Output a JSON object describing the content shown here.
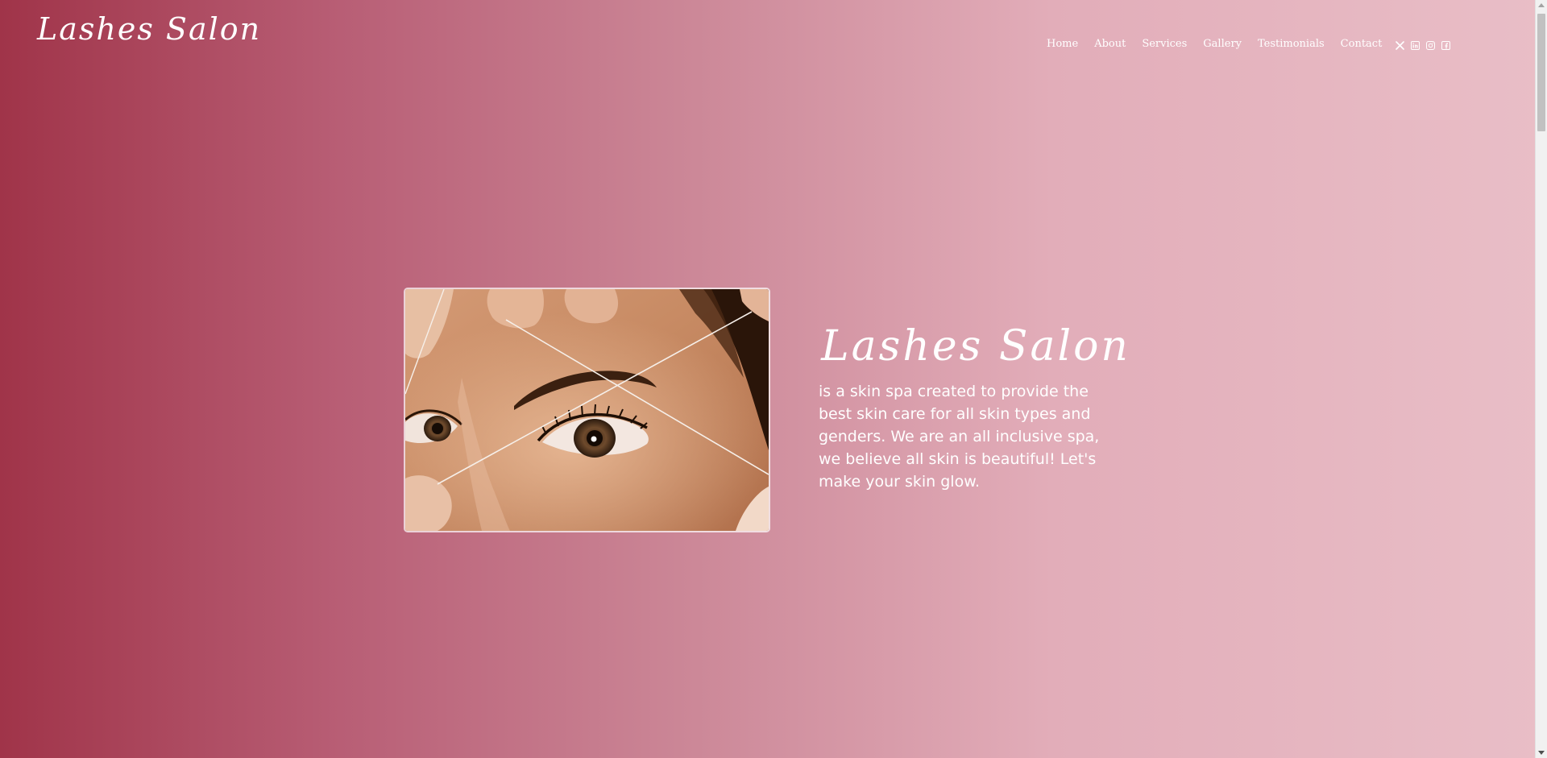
{
  "header": {
    "logo": "Lashes Salon",
    "nav": [
      "Home",
      "About",
      "Services",
      "Gallery",
      "Testimonials",
      "Contact"
    ],
    "socials": [
      "x-icon",
      "linkedin-icon",
      "instagram-icon",
      "facebook-icon"
    ]
  },
  "hero": {
    "title": "Lashes Salon",
    "description": "is a skin spa created to provide the best skin care for all skin types and genders. We are an all inclusive spa, we believe all skin is beautiful! Let's make your skin glow.",
    "image_icon": "eyebrow-threading-photo"
  },
  "colors": {
    "gradient_start": "#a03449",
    "gradient_end": "#e9bec7",
    "text": "#ffffff"
  }
}
